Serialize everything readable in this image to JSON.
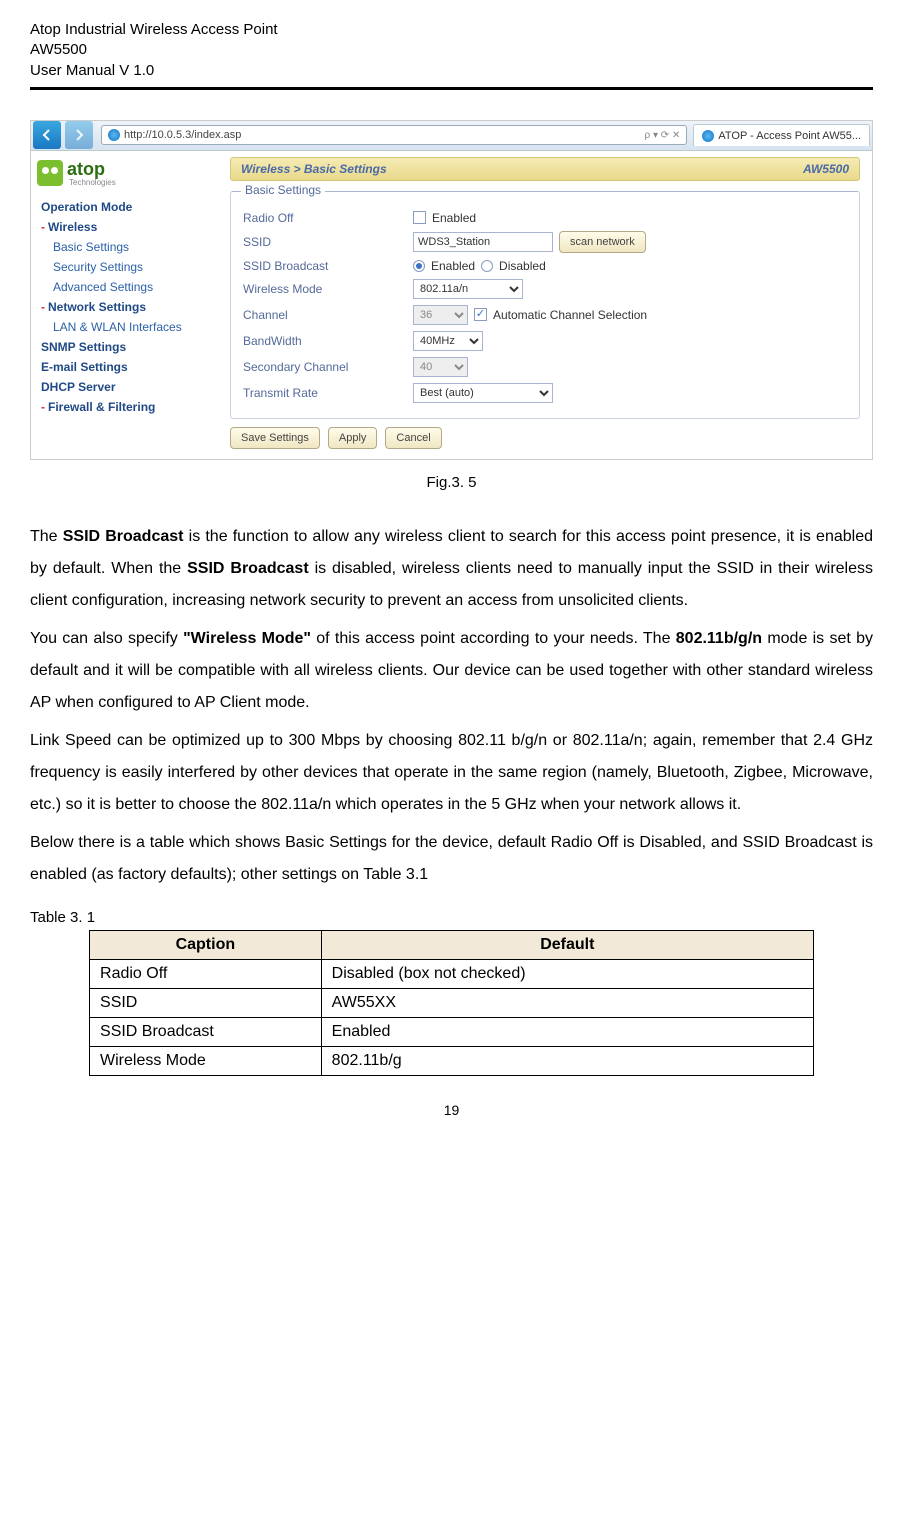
{
  "header": {
    "line1": "Atop Industrial Wireless Access Point",
    "line2": "AW5500",
    "line3": "User Manual V 1.0"
  },
  "browser": {
    "url": "http://10.0.5.3/index.asp",
    "url_suffix": "ρ ▾ ⟳ ✕",
    "tab_title": "ATOP - Access Point AW55..."
  },
  "sidebar": {
    "logo_text": "atop",
    "logo_sub": "Technologies",
    "items": [
      {
        "label": "Operation Mode",
        "bold": true
      },
      {
        "label": "Wireless",
        "bold": true,
        "dash": true
      },
      {
        "label": "Basic Settings",
        "sub": true
      },
      {
        "label": "Security Settings",
        "sub": true
      },
      {
        "label": "Advanced Settings",
        "sub": true
      },
      {
        "label": "Network Settings",
        "bold": true,
        "dash": true
      },
      {
        "label": "LAN & WLAN Interfaces",
        "sub": true
      },
      {
        "label": "SNMP Settings",
        "bold": true
      },
      {
        "label": "E-mail Settings",
        "bold": true
      },
      {
        "label": "DHCP Server",
        "bold": true
      },
      {
        "label": "Firewall & Filtering",
        "bold": true,
        "dash": true
      }
    ]
  },
  "crumb": {
    "path": "Wireless > Basic Settings",
    "model": "AW5500"
  },
  "fieldset": {
    "title": "Basic Settings",
    "rows": {
      "radio_off": {
        "label": "Radio Off",
        "enabled_text": "Enabled"
      },
      "ssid": {
        "label": "SSID",
        "value": "WDS3_Station",
        "scan_btn": "scan network"
      },
      "ssid_broadcast": {
        "label": "SSID Broadcast",
        "enabled": "Enabled",
        "disabled": "Disabled"
      },
      "wireless_mode": {
        "label": "Wireless Mode",
        "value": "802.11a/n"
      },
      "channel": {
        "label": "Channel",
        "value": "36",
        "auto_text": "Automatic Channel Selection"
      },
      "bandwidth": {
        "label": "BandWidth",
        "value": "40MHz"
      },
      "secondary_channel": {
        "label": "Secondary Channel",
        "value": "40"
      },
      "transmit_rate": {
        "label": "Transmit Rate",
        "value": "Best (auto)"
      }
    },
    "buttons": {
      "save": "Save Settings",
      "apply": "Apply",
      "cancel": "Cancel"
    }
  },
  "figure_caption": "Fig.3. 5",
  "paragraphs": {
    "p1a": "The ",
    "p1b": "SSID Broadcast",
    "p1c": " is the function to allow any wireless client to search for this access point presence, it is enabled by default. When the ",
    "p1d": "SSID Broadcast",
    "p1e": " is disabled, wireless clients need to manually input the SSID in their wireless client configuration, increasing network security to prevent an access from unsolicited clients.",
    "p2a": "You can also specify ",
    "p2b": "\"Wireless Mode\"",
    "p2c": " of this access point according to your needs. The ",
    "p2d": "802.11b/g/n",
    "p2e": " mode is set by default and it will be compatible with all wireless clients. Our device can be used together with other standard wireless AP when configured to AP Client mode.",
    "p3": "Link Speed can be optimized up to 300 Mbps by choosing 802.11 b/g/n or 802.11a/n; again, remember that 2.4 GHz frequency is easily interfered by other devices that operate in the same region (namely, Bluetooth, Zigbee, Microwave, etc.) so it is better to choose the 802.11a/n which operates in the 5 GHz when your network allows it.",
    "p4": "Below there is a table which shows Basic Settings for the device, default Radio Off is Disabled, and SSID Broadcast is enabled (as factory defaults); other settings on Table 3.1"
  },
  "table": {
    "caption": "Table 3. 1",
    "head_caption": "Caption",
    "head_default": "Default",
    "rows": [
      {
        "caption": "Radio Off",
        "default": "Disabled (box not checked)"
      },
      {
        "caption": "SSID",
        "default": "AW55XX"
      },
      {
        "caption": "SSID Broadcast",
        "default": "Enabled"
      },
      {
        "caption": "Wireless Mode",
        "default": "802.11b/g"
      }
    ]
  },
  "page_number": "19"
}
